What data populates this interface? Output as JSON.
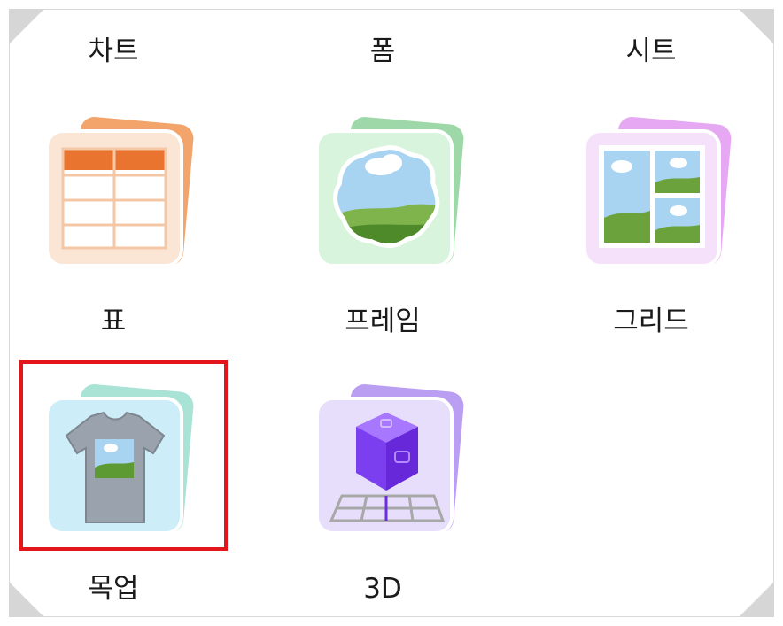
{
  "top_labels": [
    "차트",
    "폼",
    "시트"
  ],
  "items": [
    {
      "label": "표",
      "icon": "table-icon"
    },
    {
      "label": "프레임",
      "icon": "frame-icon"
    },
    {
      "label": "그리드",
      "icon": "grid-icon"
    },
    {
      "label": "목업",
      "icon": "tshirt-mockup-icon"
    },
    {
      "label": "3D",
      "icon": "cube-3d-icon"
    }
  ],
  "colors": {
    "highlight": "#e3161b",
    "table_accent": "#e8742f",
    "frame_accent": "#8fcf9a",
    "grid_accent": "#d58ae8",
    "mockup_accent": "#7fd6c8",
    "cube_accent": "#8a4cf0"
  }
}
